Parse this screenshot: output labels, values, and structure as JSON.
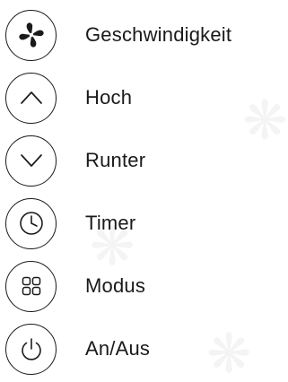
{
  "legend": {
    "items": [
      {
        "label": "Geschwindigkeit",
        "icon": "fan-speed-icon"
      },
      {
        "label": "Hoch",
        "icon": "chevron-up-icon"
      },
      {
        "label": "Runter",
        "icon": "chevron-down-icon"
      },
      {
        "label": "Timer",
        "icon": "clock-icon"
      },
      {
        "label": "Modus",
        "icon": "grid-icon"
      },
      {
        "label": "An/Aus",
        "icon": "power-icon"
      }
    ]
  },
  "colors": {
    "ink": "#1a1a1a",
    "background": "#ffffff",
    "watermark": "#f4f4f4"
  }
}
